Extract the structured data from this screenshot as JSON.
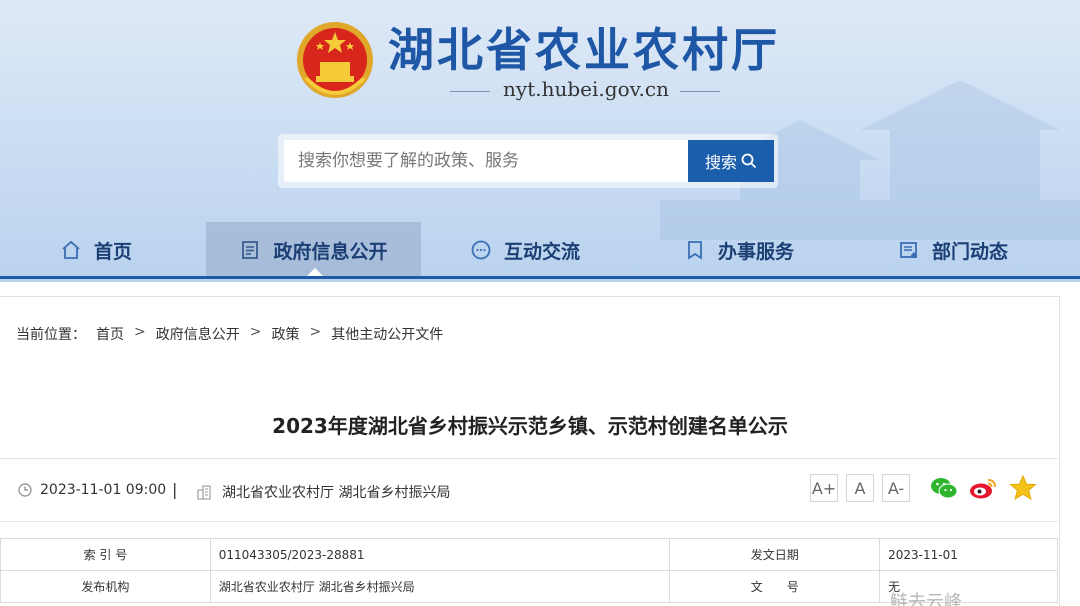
{
  "header": {
    "site_name": "湖北省农业农村厅",
    "domain": "nyt.hubei.gov.cn"
  },
  "search": {
    "placeholder": "搜索你想要了解的政策、服务",
    "button_label": "搜索"
  },
  "nav": {
    "items": [
      {
        "label": "首页",
        "icon": "home-icon",
        "active": false
      },
      {
        "label": "政府信息公开",
        "icon": "document-icon",
        "active": true
      },
      {
        "label": "互动交流",
        "icon": "chat-icon",
        "active": false
      },
      {
        "label": "办事服务",
        "icon": "bookmark-icon",
        "active": false
      },
      {
        "label": "部门动态",
        "icon": "news-icon",
        "active": false
      }
    ]
  },
  "breadcrumb": {
    "prefix": "当前位置：",
    "items": [
      "首页",
      "政府信息公开",
      "政策",
      "其他主动公开文件"
    ],
    "separator": ">"
  },
  "article": {
    "title": "2023年度湖北省乡村振兴示范乡镇、示范村创建名单公示",
    "datetime": "2023-11-01 09:00",
    "divider": "|",
    "source": "湖北省农业农村厅 湖北省乡村振兴局",
    "font_buttons": [
      "A+",
      "A",
      "A-"
    ],
    "share_icons": [
      "wechat-icon",
      "weibo-icon",
      "favorite-star-icon"
    ]
  },
  "info_table": {
    "rows": [
      {
        "label1": "索 引 号",
        "value1": "011043305/2023-28881",
        "label2": "发文日期",
        "value2": "2023-11-01"
      },
      {
        "label1": "发布机构",
        "value1": "湖北省农业农村厅 湖北省乡村振兴局",
        "label2": "文　　号",
        "value2": "无"
      }
    ]
  },
  "watermark": "鲢去云峰",
  "colors": {
    "brand_blue": "#1d57a5",
    "search_button": "#1b5eab",
    "nav_text": "#1b3f74"
  }
}
